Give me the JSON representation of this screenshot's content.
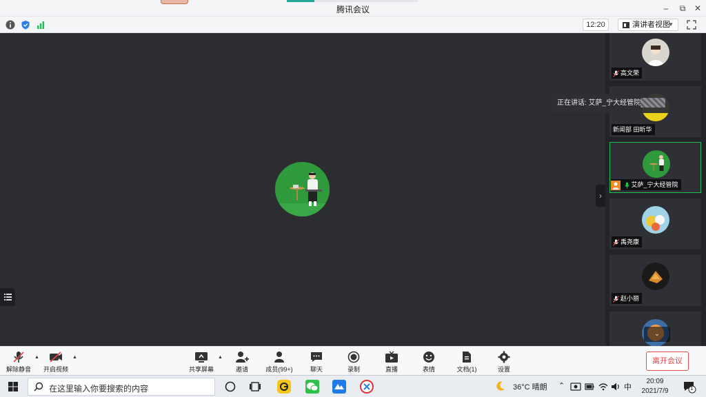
{
  "window": {
    "title": "腾讯会议"
  },
  "infobar": {
    "time": "12:20",
    "view_label": "演讲者视图"
  },
  "speaking": {
    "label": "正在讲话: 艾萨_宁大经管院"
  },
  "participants": [
    {
      "name": "高文荣",
      "muted": true,
      "color": "#d9d6cf"
    },
    {
      "name": "新闻部 田昕华",
      "muted": false,
      "color": "#e8d21c"
    },
    {
      "name": "艾萨_宁大经管院",
      "muted": false,
      "speaking": true,
      "color": "#2f9a3c"
    },
    {
      "name": "禹尧康",
      "muted": true,
      "color": "#9fd4e8"
    },
    {
      "name": "赵小丽",
      "muted": true,
      "color": "#1a1a1a"
    },
    {
      "name": "",
      "muted": true,
      "color": "#3d6ea8"
    }
  ],
  "toolbar": {
    "unmute": "解除静音",
    "start_video": "开启视频",
    "share": "共享屏幕",
    "invite": "邀请",
    "members": "成员(99+)",
    "chat": "聊天",
    "record": "录制",
    "live": "直播",
    "reactions": "表情",
    "docs": "文档(1)",
    "settings": "设置",
    "leave": "离开会议"
  },
  "taskbar": {
    "search_placeholder": "在这里输入你要搜索的内容",
    "weather": "36°C 晴朗",
    "ime": "中",
    "time": "20:09",
    "date": "2021/7/9",
    "notifications": "1"
  },
  "colors": {
    "accent_green": "#1fbf55",
    "leave_red": "#e5484d",
    "stage_bg": "#2b2d31"
  }
}
